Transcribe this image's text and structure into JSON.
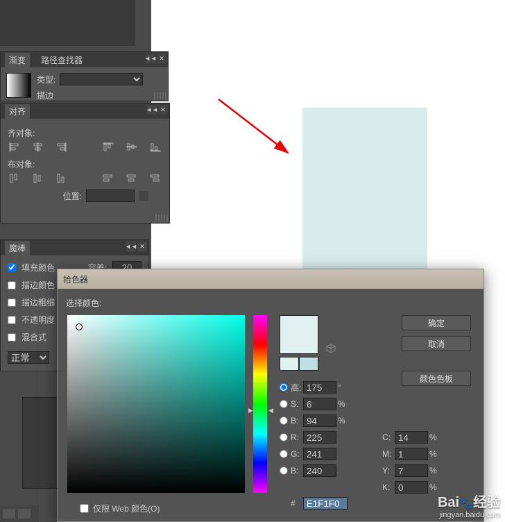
{
  "gradient_panel": {
    "tab_gradient": "渐变",
    "tab_pathfinder": "路径查找器",
    "type_label": "类型:",
    "stroke_label": "描边"
  },
  "align_panel": {
    "tab": "对齐",
    "align_label": "齐对象:",
    "distribute_label": "布对象:",
    "position_label": "位置:"
  },
  "wand_panel": {
    "tab": "魔棒",
    "fill_color": "填充颜色",
    "tolerance_label": "容差:",
    "tolerance_value": "20",
    "stroke_color": "描边颜色",
    "stroke_weight": "描边粗细",
    "opacity": "不透明度",
    "blend_mode": "混合式",
    "normal": "正常"
  },
  "picker": {
    "title": "拾色器",
    "select_label": "选择颜色:",
    "ok": "确定",
    "cancel": "取消",
    "swatches": "颜色色板",
    "h_label": "高:",
    "h_value": "175",
    "h_unit": "°",
    "s_label": "S:",
    "s_value": "6",
    "s_unit": "%",
    "b_label": "B:",
    "b_value": "94",
    "b_unit": "%",
    "r_label": "R:",
    "r_value": "225",
    "g_label": "G:",
    "g_value": "241",
    "b2_label": "B:",
    "b2_value": "240",
    "c_label": "C:",
    "c_value": "14",
    "c_unit": "%",
    "m_label": "M:",
    "m_value": "1",
    "m_unit": "%",
    "y_label": "Y:",
    "y_value": "7",
    "y_unit": "%",
    "k_label": "K:",
    "k_value": "0",
    "k_unit": "%",
    "hex_label": "#",
    "hex_value": "E1F1F0",
    "web_only": "仅限 Web 颜色(O)",
    "current_color": "#e1f1f0",
    "compare_color": "#bfe0e0"
  },
  "watermark": {
    "brand": "Bai",
    "brand2": "经验",
    "url": "jingyan.baidu.com"
  }
}
